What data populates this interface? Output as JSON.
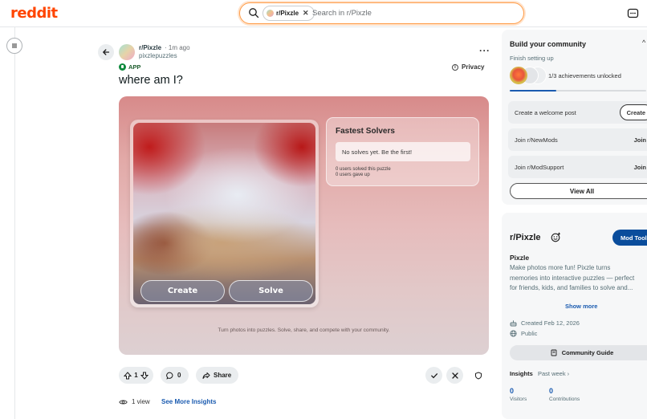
{
  "header": {
    "logo": "reddit",
    "search_chip": "r/Pixzle",
    "search_placeholder": "Search in r/Pixzle"
  },
  "post": {
    "subreddit": "r/Pixzle",
    "time": "· 1m ago",
    "author": "pixzlepuzzles",
    "badge": "APP",
    "privacy": "Privacy",
    "title": "where am I?"
  },
  "app": {
    "create_label": "Create",
    "solve_label": "Solve",
    "solvers_title": "Fastest Solvers",
    "solvers_empty": "No solves yet. Be the first!",
    "stat_solved": "0 users solved this puzzle",
    "stat_gaveup": "0 users gave up",
    "tagline": "Turn photos into puzzles. Solve, share, and compete with your community."
  },
  "actions": {
    "votes": "1",
    "comments": "0",
    "share": "Share",
    "views": "1 view",
    "insights_link": "See More Insights"
  },
  "sidebar": {
    "build_title": "Build your community",
    "build_sub": "Finish setting up",
    "achievements": "1/3 achievements unlocked",
    "achievement_progress": 0.34,
    "tasks": [
      {
        "label": "Create a welcome post",
        "button": "Create"
      },
      {
        "label": "Join r/NewMods",
        "button": "Join"
      },
      {
        "label": "Join r/ModSupport",
        "button": "Join"
      }
    ],
    "view_all": "View All",
    "community": {
      "name": "r/Pixzle",
      "mod_tools": "Mod Tools",
      "title": "Pixzle",
      "description_lines": [
        "Make photos more fun! Pixzle turns",
        "memories into interactive puzzles — perfect",
        "for friends, kids, and families to solve and..."
      ],
      "show_more": "Show more",
      "created": "Created Feb 12, 2026",
      "visibility": "Public",
      "guide": "Community Guide",
      "insights_label": "Insights",
      "insights_range": "Past week ›",
      "visitors_value": "0",
      "visitors_label": "Visitors",
      "contributions_value": "0",
      "contributions_label": "Contributions"
    }
  },
  "colors": {
    "brand": "#ff4500",
    "link": "#1a5bb0",
    "mod_tools_bg": "#0a4d9c"
  }
}
